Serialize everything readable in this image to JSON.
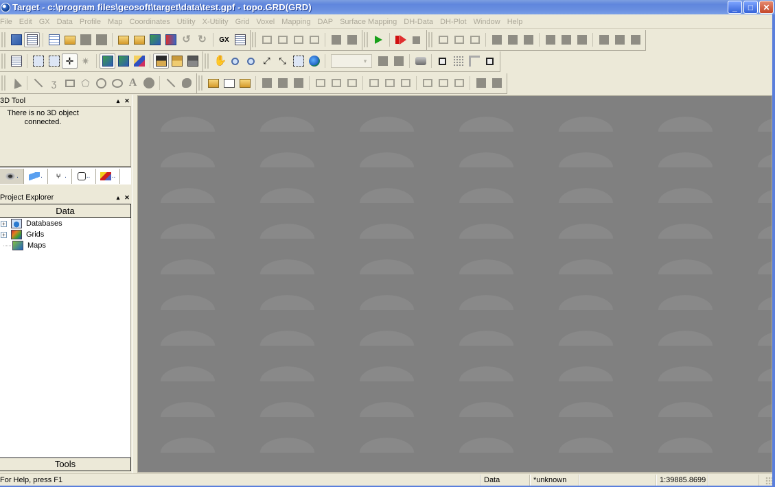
{
  "window": {
    "title": "Target - c:\\program files\\geosoft\\target\\data\\test.gpf - topo.GRD(GRD)",
    "minimize_label": "_",
    "maximize_label": "□",
    "close_label": "✕"
  },
  "menubar": {
    "items": [
      "File",
      "Edit",
      "GX",
      "Data",
      "Profile",
      "Map",
      "Coordinates",
      "Utility",
      "X-Utility",
      "Grid",
      "Voxel",
      "Mapping",
      "DAP",
      "Surface Mapping",
      "DH-Data",
      "DH-Plot",
      "Window",
      "Help"
    ]
  },
  "toolbar": {
    "gx_label": "GX",
    "zoom_combo_value": "",
    "zoom_combo_arrow": "▾"
  },
  "panels": {
    "threed_tool": {
      "title": "3D Tool",
      "message": "There is no 3D object connected.",
      "tabs": [
        {
          "icon": "eye-icon",
          "label": "."
        },
        {
          "icon": "plane-icon",
          "label": "."
        },
        {
          "icon": "axes-icon",
          "label": "."
        },
        {
          "icon": "cube-icon",
          "label": ".."
        },
        {
          "icon": "blocks-icon",
          "label": ".."
        }
      ]
    },
    "project_explorer": {
      "title": "Project Explorer",
      "data_tab": "Data",
      "tree": [
        {
          "label": "Databases",
          "expandable": true
        },
        {
          "label": "Grids",
          "expandable": true
        },
        {
          "label": "Maps",
          "expandable": false
        }
      ],
      "tools_tab": "Tools"
    },
    "pin_glyph": "▴",
    "close_glyph": "✕"
  },
  "statusbar": {
    "help": "For Help, press F1",
    "mode": "Data",
    "projection": "*unknown",
    "pane3": "",
    "scale": "1:39885.8699",
    "pane5": ""
  },
  "colors": {
    "title_bar": "#6a8fe0",
    "chrome": "#ece9d8",
    "canvas": "#808080",
    "disabled_text": "#aca899"
  }
}
